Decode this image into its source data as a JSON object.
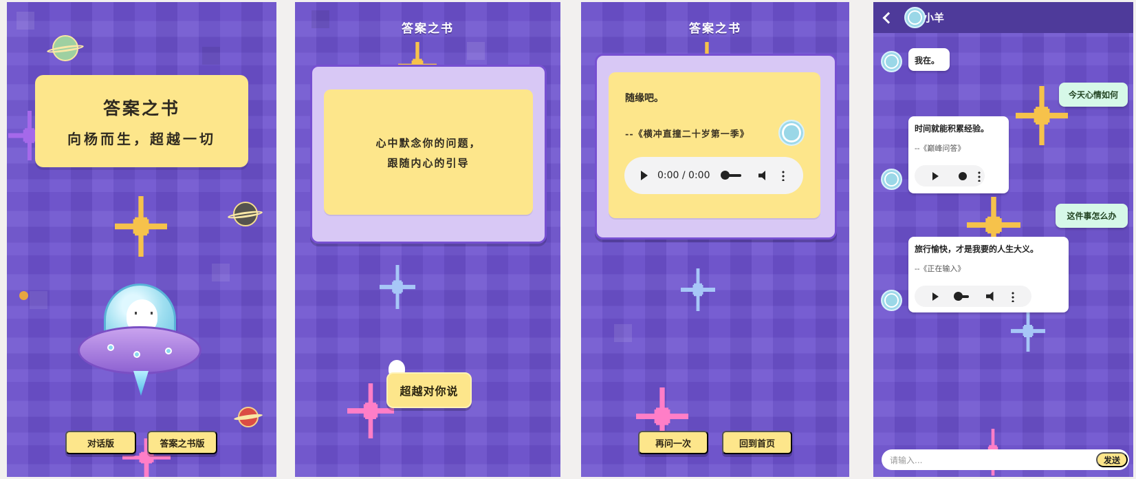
{
  "colors": {
    "background_purple": "#6d52cf",
    "card_yellow": "#fde68b",
    "card_lilac": "#d8c8f5",
    "user_bubble": "#d6f8e8",
    "white": "#ffffff"
  },
  "home": {
    "title": "答案之书",
    "subtitle": "向杨而生，超越一切",
    "buttons": [
      "对话版",
      "答案之书版"
    ],
    "icons": [
      "planet-icon",
      "ufo-sheep-icon"
    ]
  },
  "question": {
    "title": "答案之书",
    "prompt_lines": [
      "心中默念你的问题，",
      "跟随内心的引导"
    ],
    "button": "超越对你说"
  },
  "answer": {
    "title": "答案之书",
    "text": "随缘吧。",
    "source": "--《横冲直撞二十岁第一季》",
    "audio_time": "0:00 / 0:00",
    "buttons": [
      "再问一次",
      "回到首页"
    ]
  },
  "chat": {
    "header_name": "小羊",
    "messages": [
      {
        "from": "bot",
        "text": "我在。"
      },
      {
        "from": "user",
        "text": "今天心情如何"
      },
      {
        "from": "bot",
        "text": "时间就能积累经验。",
        "source": "--《巅峰问答》"
      },
      {
        "from": "user",
        "text": "这件事怎么办"
      },
      {
        "from": "bot",
        "text": "旅行愉快，才是我要的人生大义。",
        "source": "--《正在输入》"
      }
    ],
    "input_placeholder": "请输入...",
    "send_label": "发送"
  }
}
